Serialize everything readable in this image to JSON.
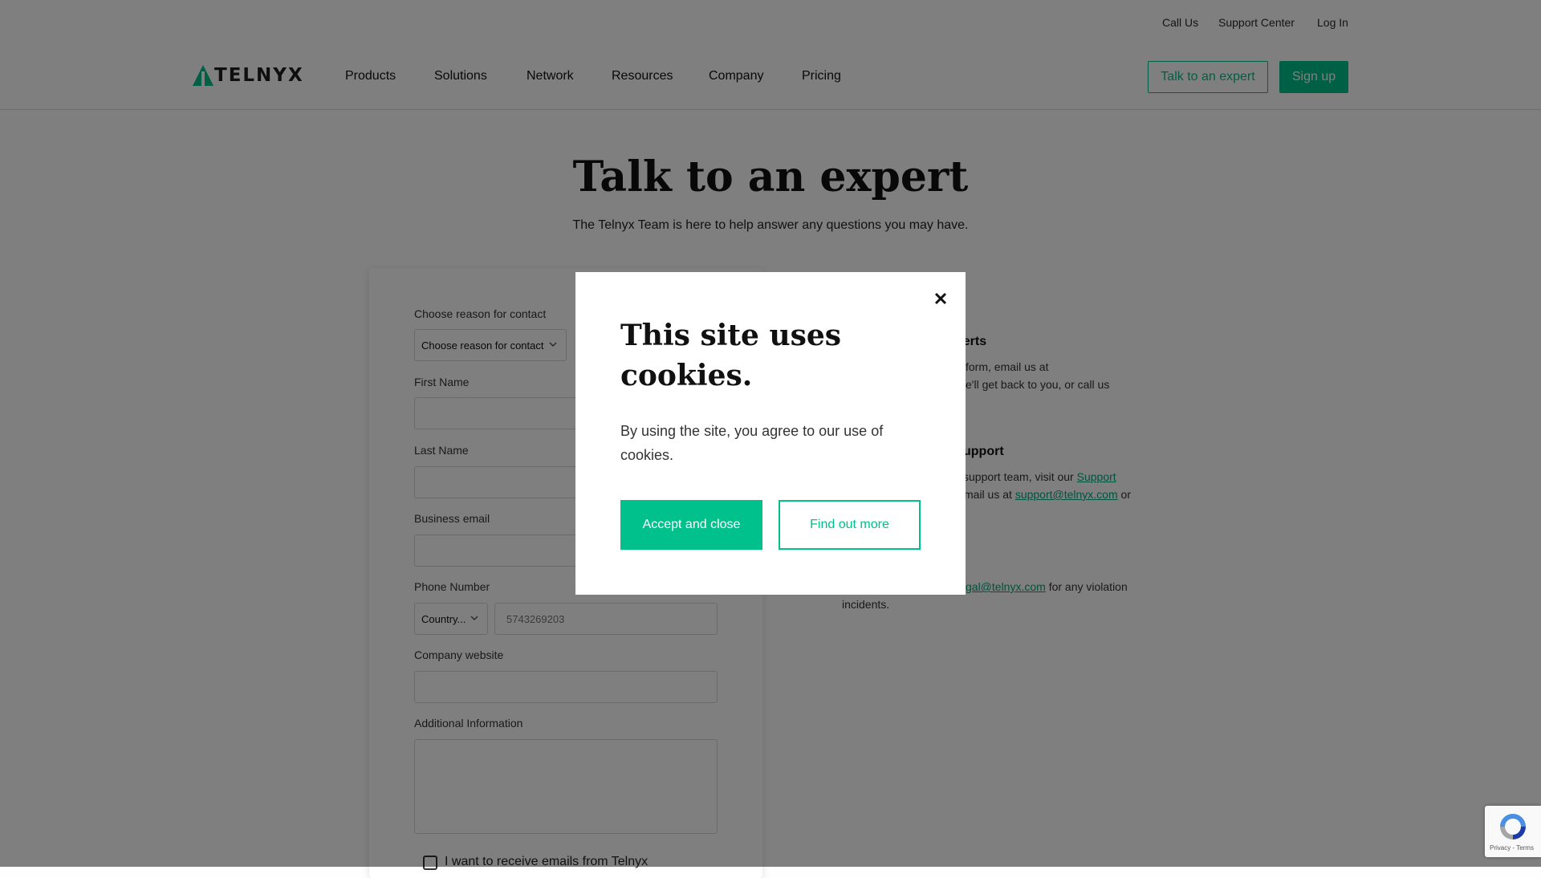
{
  "utility_nav": {
    "call_us": "Call Us",
    "support_center": "Support Center",
    "log_in": "Log In"
  },
  "header": {
    "logo_text": "TELNYX",
    "nav": [
      "Products",
      "Solutions",
      "Network",
      "Resources",
      "Company",
      "Pricing"
    ],
    "talk_button": "Talk to an expert",
    "signup_button": "Sign up"
  },
  "hero": {
    "title": "Talk to an expert",
    "subtitle": "The Telnyx Team is here to help answer any questions you may have."
  },
  "form": {
    "reason_label": "Choose reason for contact",
    "reason_value": "Choose reason for contact",
    "first_name_label": "First Name",
    "last_name_label": "Last Name",
    "email_label": "Business email",
    "phone_label": "Phone Number",
    "country_value": "Country...",
    "phone_placeholder": "5743269203",
    "website_label": "Company website",
    "additional_label": "Additional Information",
    "newsletter_label": "I want to receive emails from Telnyx"
  },
  "info": {
    "experts_heading": "perts",
    "experts_line1": "form, email us at",
    "experts_line2": "e'll get back to you, or call us",
    "support_heading": "upport",
    "support_line1_text": "support team, visit our ",
    "support_line1_link": "Support",
    "support_line2_text": "mail us at ",
    "support_line2_link": "support@telnyx.com",
    "support_line2_tail": " or",
    "legal_link": "gal@telnyx.com",
    "legal_tail": " for any violation",
    "legal_line2": "incidents."
  },
  "cookie_modal": {
    "title": "This site uses cookies.",
    "body": "By using the site, you agree to our use of cookies.",
    "accept_button": "Accept and close",
    "find_button": "Find out more"
  },
  "recaptcha": {
    "footer": "Privacy - Terms"
  },
  "colors": {
    "accent": "#00c08b",
    "overlay": "rgba(0,0,0,0.5)"
  }
}
